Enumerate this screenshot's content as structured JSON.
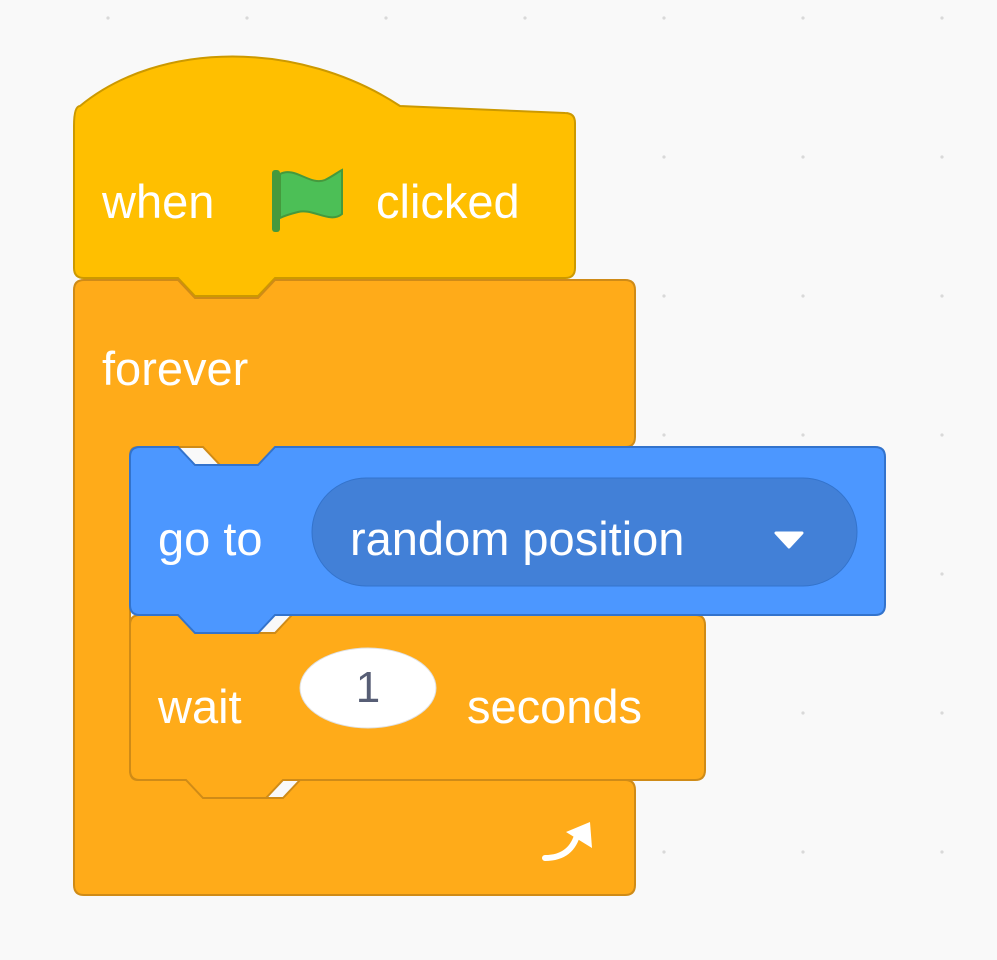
{
  "event_block": {
    "prefix": "when",
    "icon": "green-flag-icon",
    "suffix": "clicked",
    "color": "#ffbf00",
    "flag_color": "#4cbf56"
  },
  "forever_block": {
    "label": "forever",
    "color": "#ffab19",
    "loop_icon": "loop-arrow-icon"
  },
  "motion_block": {
    "label": "go to",
    "dropdown_value": "random position",
    "dropdown_icon": "dropdown-triangle-icon",
    "color": "#4c97ff",
    "dropdown_color": "#4280d7"
  },
  "wait_block": {
    "prefix": "wait",
    "input_value": "1",
    "suffix": "seconds",
    "color": "#ffab19"
  }
}
